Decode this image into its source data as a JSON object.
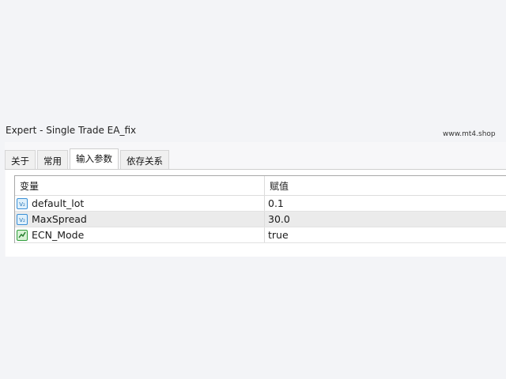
{
  "window": {
    "title": "Expert - Single Trade EA_fix",
    "watermark": "www.mt4.shop"
  },
  "tabs": [
    {
      "label": "关于",
      "active": false
    },
    {
      "label": "常用",
      "active": false
    },
    {
      "label": "输入参数",
      "active": true
    },
    {
      "label": "依存关系",
      "active": false
    }
  ],
  "grid": {
    "headers": {
      "name": "变量",
      "value": "赋值"
    },
    "rows": [
      {
        "name": "default_lot",
        "value": "0.1",
        "icon": "double-value-icon",
        "selected": false
      },
      {
        "name": "MaxSpread",
        "value": "30.0",
        "icon": "double-value-icon",
        "selected": true
      },
      {
        "name": "ECN_Mode",
        "value": "true",
        "icon": "boolean-value-icon",
        "selected": false
      }
    ]
  },
  "colors": {
    "double_icon": "#3a8fd6",
    "boolean_icon": "#2e9d3a",
    "selected_row": "#ebebeb"
  }
}
